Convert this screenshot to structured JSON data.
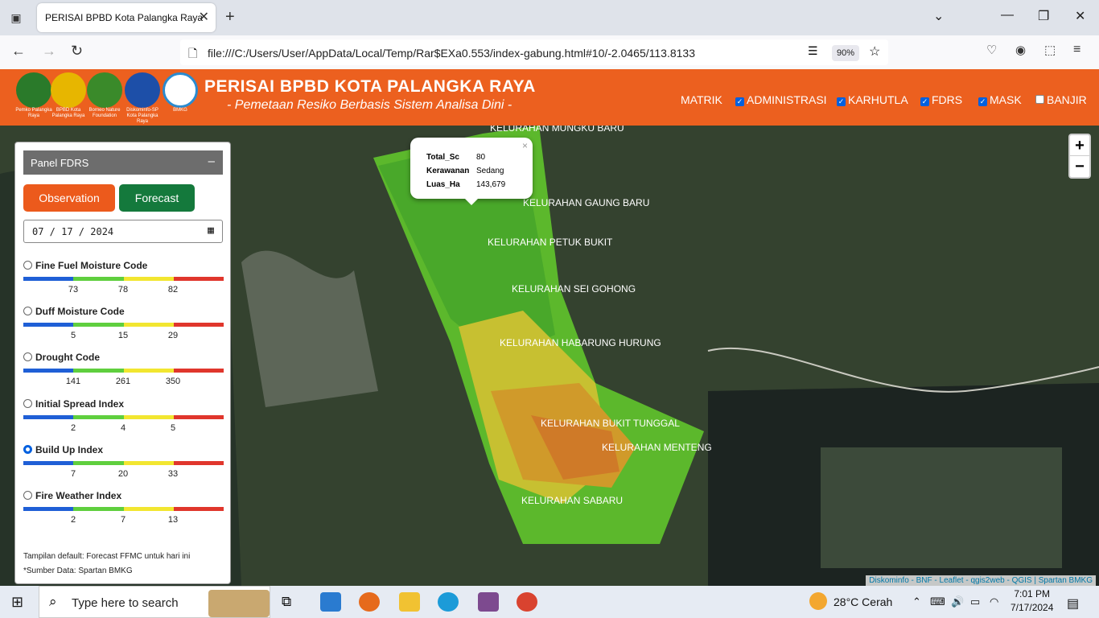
{
  "browser": {
    "tab_title": "PERISAI BPBD Kota Palangka Raya",
    "url": "file:///C:/Users/User/AppData/Local/Temp/Rar$EXa0.553/index-gabung.html#10/-2.0465/113.8133",
    "zoom": "90%"
  },
  "header": {
    "title": "PERISAI BPBD KOTA PALANGKA RAYA",
    "subtitle": "- Pemetaan Resiko Berbasis Sistem Analisa Dini -",
    "logos": [
      {
        "caption": "Pemko Palangka Raya"
      },
      {
        "caption": "BPBD Kota Palangka Raya"
      },
      {
        "caption": "Borneo Nature Foundation"
      },
      {
        "caption": "Diskominfo-SP Kota Palangka Raya"
      },
      {
        "caption": "BMKG"
      }
    ],
    "menu": [
      {
        "label": "MATRIK"
      },
      {
        "label": "ADMINISTRASI",
        "checked": true
      },
      {
        "label": "KARHUTLA",
        "checked": true
      },
      {
        "label": "FDRS",
        "checked": true
      },
      {
        "label": "MASK",
        "checked": true
      },
      {
        "label": "BANJIR",
        "checked": false
      }
    ]
  },
  "map": {
    "labels": [
      "KELURAHAN MUNGKU BARU",
      "KELURAHAN GAUNG BARU",
      "KELURAHAN PETUK BUKIT",
      "KELURAHAN SEI GOHONG",
      "KELURAHAN HABARUNG HURUNG",
      "KELURAHAN BUKIT TUNGGAL",
      "KELURAHAN MENTENG",
      "KELURAHAN SABARU"
    ],
    "popup": {
      "rows": [
        {
          "key": "Total_Sc",
          "value": "80"
        },
        {
          "key": "Kerawanan",
          "value": "Sedang"
        },
        {
          "key": "Luas_Ha",
          "value": "143,679"
        }
      ],
      "close": "×"
    },
    "zoom_in": "+",
    "zoom_out": "−",
    "attribution": "Diskominfo - BNF - Leaflet - qgis2web - QGIS | Spartan BMKG"
  },
  "panel": {
    "title": "Panel FDRS",
    "minimize": "–",
    "btn_observation": "Observation",
    "btn_forecast": "Forecast",
    "date": "07 / 17 / 2024",
    "indices": [
      {
        "label": "Fine Fuel Moisture Code",
        "ticks": [
          "73",
          "78",
          "82"
        ],
        "selected": false
      },
      {
        "label": "Duff Moisture Code",
        "ticks": [
          "5",
          "15",
          "29"
        ],
        "selected": false
      },
      {
        "label": "Drought Code",
        "ticks": [
          "141",
          "261",
          "350"
        ],
        "selected": false
      },
      {
        "label": "Initial Spread Index",
        "ticks": [
          "2",
          "4",
          "5"
        ],
        "selected": false
      },
      {
        "label": "Build Up Index",
        "ticks": [
          "7",
          "20",
          "33"
        ],
        "selected": true
      },
      {
        "label": "Fire Weather Index",
        "ticks": [
          "2",
          "7",
          "13"
        ],
        "selected": false
      }
    ],
    "note1": "Tampilan default: Forecast FFMC untuk hari ini",
    "note2": "*Sumber Data: Spartan BMKG",
    "colors": {
      "blue": "#1f5fd6",
      "green": "#5fcf3e",
      "yellow": "#f2e630",
      "red": "#e0362c"
    }
  },
  "taskbar": {
    "search_placeholder": "Type here to search",
    "weather": "28°C  Cerah",
    "time": "7:01 PM",
    "date": "7/17/2024"
  }
}
